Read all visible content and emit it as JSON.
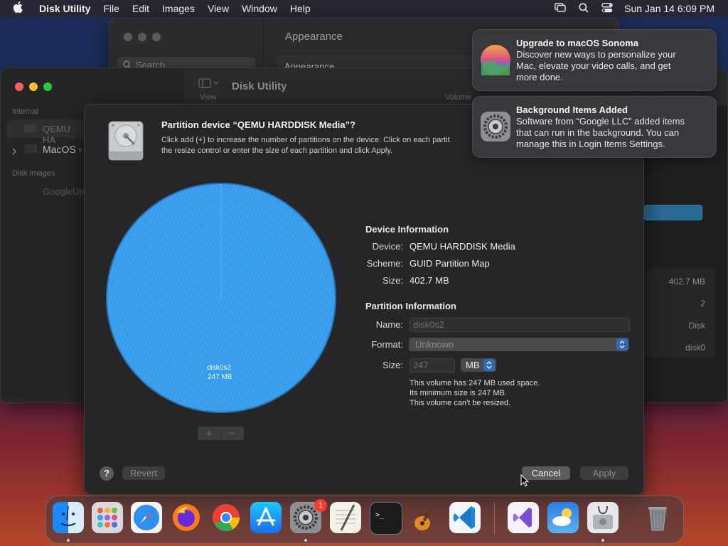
{
  "menubar": {
    "app_name": "Disk Utility",
    "items": [
      "File",
      "Edit",
      "Images",
      "View",
      "Window",
      "Help"
    ],
    "clock": "Sun Jan 14  6:09 PM"
  },
  "settings_window": {
    "title": "Appearance",
    "search_placeholder": "Search",
    "row_label": "Appearance"
  },
  "disk_utility": {
    "title": "Disk Utility",
    "view_label": "View",
    "volume_label": "Volume",
    "sidebar": {
      "section_internal": "Internal",
      "item_qemu": "QEMU HA",
      "item_macos": "MacOS",
      "item_macos_suffix": "v",
      "section_images": "Disk Images",
      "item_google": "GoogleUp"
    },
    "info_values": [
      "402.7 MB",
      "2",
      "Disk",
      "disk0"
    ]
  },
  "sheet": {
    "title": "Partition device “QEMU HARDDISK Media”?",
    "description_1": "Click add (+) to increase the number of partitions on the device. Click on each partit",
    "description_2": "the resize control or enter the size of each partition and click Apply.",
    "pie_label": "disk0s2",
    "pie_size": "247 MB",
    "add_label": "+",
    "remove_label": "−",
    "device_info": {
      "header": "Device Information",
      "device_label": "Device:",
      "device_value": "QEMU HARDDISK Media",
      "scheme_label": "Scheme:",
      "scheme_value": "GUID Partition Map",
      "size_label": "Size:",
      "size_value": "402.7 MB"
    },
    "partition_info": {
      "header": "Partition Information",
      "name_label": "Name:",
      "name_value": "disk0s2",
      "format_label": "Format:",
      "format_value": "Unknown",
      "size_label": "Size:",
      "size_value": "247",
      "unit_value": "MB",
      "note_1": "This volume has 247 MB used space.",
      "note_2": "Its minimum size is 247 MB.",
      "note_3": "This volume can't be resized."
    },
    "help_label": "?",
    "revert_label": "Revert",
    "cancel_label": "Cancel",
    "apply_label": "Apply"
  },
  "notifications": [
    {
      "title": "Upgrade to macOS Sonoma",
      "body_1": "Discover new ways to personalize your",
      "body_2": "Mac, elevate your video calls, and get",
      "body_3": "more done."
    },
    {
      "title": "Background Items Added",
      "body_1": "Software from “Google LLC” added items",
      "body_2": "that can run in the background. You can",
      "body_3": "manage this in Login Items Settings."
    }
  ],
  "dock": {
    "settings_badge": "1",
    "icons": [
      "finder-icon",
      "launchpad-icon",
      "safari-icon",
      "firefox-icon",
      "chrome-icon",
      "app-store-icon",
      "system-settings-icon",
      "textedit-icon",
      "terminal-icon",
      "garageband-icon",
      "vscode-icon",
      "visual-studio-icon",
      "weather-icon",
      "disk-utility-icon",
      "trash-icon"
    ]
  },
  "colors": {
    "pie_fill": "#3aa0f0",
    "pie_edge": "#2a6fb0",
    "close": "#ff5f57",
    "minimize": "#febc2e",
    "zoom": "#28c840",
    "badge": "#ff3b30"
  }
}
